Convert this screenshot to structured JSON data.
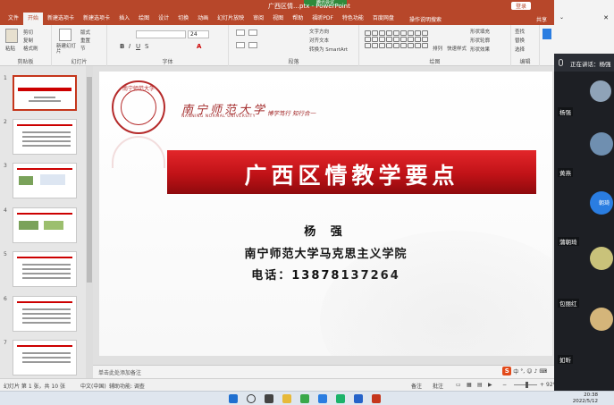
{
  "window": {
    "title": "广西区情…ptx  -  PowerPoint",
    "login_label": "登录",
    "meeting_badge": "腾讯会议"
  },
  "ribbon_tabs": [
    "文件",
    "开始",
    "新建选项卡",
    "新建选项卡",
    "插入",
    "绘图",
    "设计",
    "切换",
    "动画",
    "幻灯片放映",
    "审阅",
    "视图",
    "帮助",
    "福昕PDF",
    "特色功能",
    "百度网盘"
  ],
  "active_tab_index": 1,
  "tell_me": "操作说明搜索",
  "share_label": "共享",
  "ribbon": {
    "clipboard": {
      "label": "剪贴板",
      "paste": "粘贴",
      "cut": "剪切",
      "copy": "复制",
      "format_painter": "格式刷"
    },
    "slides": {
      "label": "幻灯片",
      "new_slide": "新建幻灯片",
      "layout": "版式",
      "reset": "重置",
      "section": "节"
    },
    "font": {
      "label": "字体",
      "size": "24"
    },
    "paragraph": {
      "label": "段落",
      "text_direction": "文字方向",
      "align_text": "对齐文本",
      "smartart": "转换为 SmartArt"
    },
    "drawing": {
      "label": "绘图",
      "arrange": "排列",
      "quick_styles": "快速样式",
      "fill": "形状填充",
      "outline": "形状轮廓",
      "effects": "形状效果"
    },
    "editing": {
      "label": "编辑",
      "find": "查找",
      "replace": "替换",
      "select": "选择"
    },
    "baidu": {
      "label": "保存",
      "save_to": "保存到百度网盘"
    }
  },
  "thumbnails": [
    {
      "num": "1",
      "title": "广西区情教学要点"
    },
    {
      "num": "2",
      "title": ""
    },
    {
      "num": "3",
      "title": ""
    },
    {
      "num": "4",
      "title": ""
    },
    {
      "num": "5",
      "title": ""
    },
    {
      "num": "6",
      "title": ""
    },
    {
      "num": "7",
      "title": ""
    }
  ],
  "slide": {
    "seal_text": "南宁师范大学",
    "university_cn": "南宁师范大学",
    "university_en": "NANNING NORMAL UNIVERSITY",
    "motto": "博学笃行 知行合一",
    "title": "广西区情教学要点",
    "author": "杨 强",
    "institution": "南宁师范大学马克思主义学院",
    "phone": "电话：13878137264"
  },
  "notes_placeholder": "单击此处添加备注",
  "status": {
    "slide_info": "幻灯片 第 1 张，共 10 张",
    "language": "中文(中国)",
    "accessibility": "辅助功能: 调查",
    "notes": "备注",
    "comments": "批注",
    "zoom": "92%"
  },
  "meeting": {
    "header": "正在讲话：杨强",
    "participants": [
      {
        "name": "杨强",
        "color": "#8fa3b8"
      },
      {
        "name": "黄燕",
        "color": "#6f8fb0"
      },
      {
        "name": "朝琦",
        "color": "#2a7de1"
      },
      {
        "name": "蒲朝琦",
        "color": "#c9c27a"
      },
      {
        "name": "包丽红",
        "color": "#d4b57a"
      },
      {
        "name": "如昕",
        "color": "#4a5a6e"
      }
    ]
  },
  "taskbar": {
    "time": "20:38",
    "date": "2022/5/12"
  }
}
